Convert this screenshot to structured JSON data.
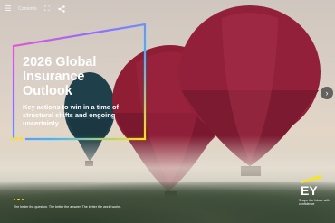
{
  "toolbar": {
    "menu_icon": "hamburger-menu-icon",
    "contents_label": "Contents",
    "fullscreen_icon": "fullscreen-icon",
    "share_icon": "share-icon"
  },
  "slide": {
    "title_line1": "2026 Global",
    "title_line2": "Insurance",
    "title_line3": "Outlook",
    "subtitle": "Key actions to win in a time of structural shifts and ongoing uncertainty"
  },
  "navigation": {
    "next_icon": "chevron-right-icon"
  },
  "footer": {
    "tagline": "The better the question. The better the answer. The better the world works.",
    "brand": "EY",
    "brand_tagline": "Shape the future with confidence"
  },
  "colors": {
    "brand_yellow": "#ffe600",
    "frame_gradient": [
      "#ff4fc4",
      "#9b6bff",
      "#3fb7ff",
      "#ffe600"
    ]
  }
}
